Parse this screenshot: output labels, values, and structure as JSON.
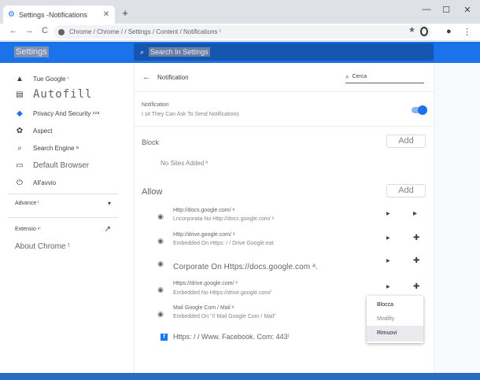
{
  "tab": {
    "title": "Settings -Notifications",
    "close": "✕",
    "favicon": "gear-icon"
  },
  "newtab": "+",
  "window_controls": {
    "minimize": "—",
    "maximize": "☐",
    "close": "✕"
  },
  "nav": {
    "back": "←",
    "forward": "→",
    "reload": "C"
  },
  "omnibox": {
    "text": "Chrome / Chrome / / Settings / Content / Notifications ᵗ",
    "star": "★"
  },
  "toolbar": {
    "profile": "●",
    "menu": "⋮"
  },
  "header": {
    "title": "Settings",
    "search_placeholder": "Search In Settings"
  },
  "sidebar": {
    "items": [
      {
        "icon": "person-icon",
        "glyph": "▲",
        "label": "Tue Google ⁱ"
      },
      {
        "icon": "clipboard-icon",
        "glyph": "▤",
        "label": "Autofill"
      },
      {
        "icon": "shield-icon",
        "glyph": "◆",
        "label": "Privacy And Security ᶻᶻᵃ"
      },
      {
        "icon": "palette-icon",
        "glyph": "✿",
        "label": "Aspect"
      },
      {
        "icon": "search-icon",
        "glyph": "⌕",
        "label": "Search Engine ᵃ"
      },
      {
        "icon": "browser-icon",
        "glyph": "▭",
        "label": "Default Browser"
      },
      {
        "icon": "power-icon",
        "glyph": "⏻",
        "label": "All'avvio"
      }
    ],
    "advanced": "Advance ᵗ",
    "advanced_caret": "▾",
    "extensions": "Extensio ⁿⁱ",
    "extensions_icon": "↗",
    "about": "About Chrome ᵗ"
  },
  "page": {
    "title": "Notification",
    "search_value": "Cerca",
    "notification_label": "Notification",
    "notification_desc": "I sit They Can Ask To Send Notifications",
    "block_title": "Block",
    "add_label": "Add",
    "no_sites": "No Sites Added ᵇ",
    "allow_title": "Allow",
    "sites": [
      {
        "title": "Http://docs.google.com/ ᵃ",
        "sub": "Lncorporata No Http://docs.google.com/ ᵃ"
      },
      {
        "title": "Http://drive.google.com/ ᵃ",
        "sub": "Embedded On Https: / / Drive Google.eat"
      },
      {
        "title": "",
        "big": "Corporate On Https://docs.google.com ᵃ."
      },
      {
        "title": "Https://drive.google.com/ ˢ",
        "sub": "Embedded No Https://drive.google.com/ⁱ"
      },
      {
        "title": "Mail Google Com / Mail ᵃ",
        "sub": "Embedded On \"// Mail Google Com / Mail\""
      }
    ],
    "facebook": "Https: / / Www. Facebook. Com: 443ˡ"
  },
  "menu": {
    "items": [
      "Blocca",
      "Modifiy",
      "Rimuovi"
    ]
  }
}
